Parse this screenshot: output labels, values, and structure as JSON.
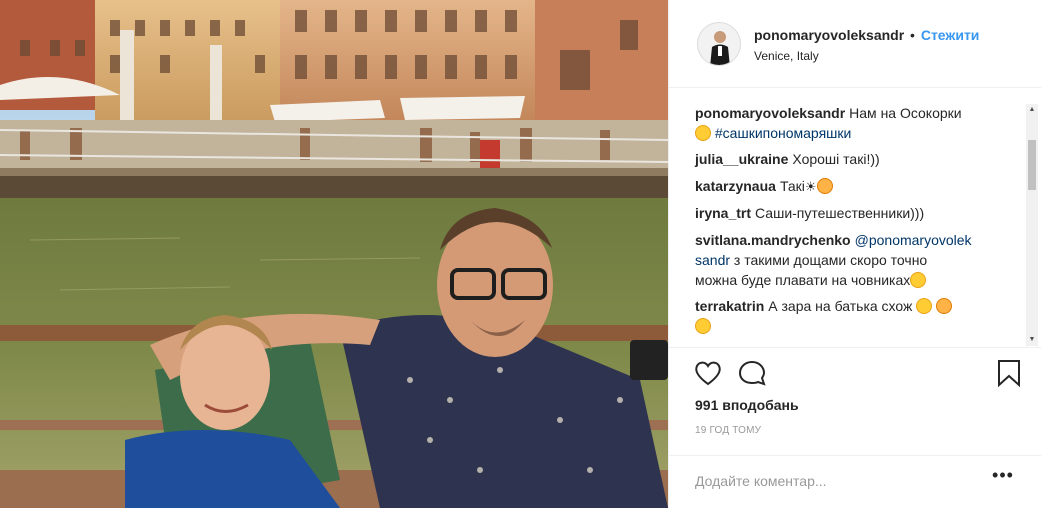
{
  "post": {
    "username": "ponomaryovoleksandr",
    "separator": "•",
    "follow_label": "Стежити",
    "location": "Venice, Italy"
  },
  "comments": [
    {
      "user": "ponomaryovoleksandr",
      "text": "Нам на Осокорки",
      "emoji_after_text": false,
      "line2_emoji": "smile-emoji",
      "line2_link": "#сашкипономаряшки"
    },
    {
      "user": "julia__ukraine",
      "text": "Хороші такі!))"
    },
    {
      "user": "katarzynaua",
      "text": "Такі",
      "sun": "☀",
      "emoji": "heart-eyes-emoji"
    },
    {
      "user": "iryna_trt",
      "text": "Саши-путешественники)))"
    },
    {
      "user": "svitlana.mandrychenko",
      "mention": "@ponomaryovolek",
      "mention_cont": "sandr",
      "text_line2": "з такими дощами скоро точно",
      "text_line3": "можна буде плавати на човниках",
      "emoji": "tears-of-joy-emoji"
    },
    {
      "user": "terrakatrin",
      "text": "А зара на батька схож",
      "emoji": [
        "smile-emoji",
        "flushed-emoji",
        "tongue-emoji"
      ]
    }
  ],
  "actions": {
    "like_icon": "heart-icon",
    "comment_icon": "speech-bubble-icon",
    "save_icon": "bookmark-icon"
  },
  "likes_text": "991 вподобань",
  "time_text": "19 год тому",
  "add_comment": {
    "placeholder": "Додайте коментар...",
    "more_label": "•••"
  },
  "colors": {
    "accent": "#3897f0",
    "link": "#003569",
    "border": "#efefef",
    "muted": "#999999"
  }
}
